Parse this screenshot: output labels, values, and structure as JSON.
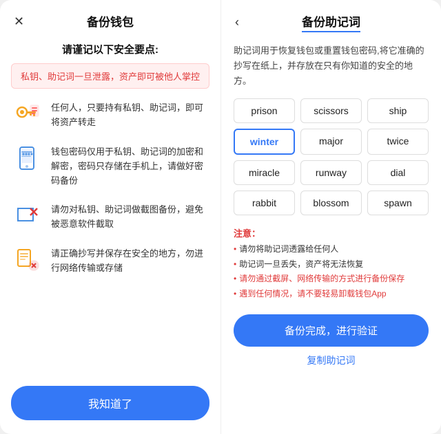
{
  "left": {
    "close_icon": "✕",
    "title": "备份钱包",
    "safety_title": "请谨记以下安全要点:",
    "warning": "私钥、助记词一旦泄露，资产即可被他人掌控",
    "items": [
      {
        "id": "key",
        "text": "任何人，只要持有私钥、助记词，即可将资产转走"
      },
      {
        "id": "phone",
        "text": "钱包密码仅用于私钥、助记词的加密和解密，密码只存储在手机上，请做好密码备份"
      },
      {
        "id": "screenshot",
        "text": "请勿对私钥、助记词做截图备份，避免被恶意软件截取"
      },
      {
        "id": "doc",
        "text": "请正确抄写并保存在安全的地方，勿进行网络传输或存储"
      }
    ],
    "confirm_label": "我知道了"
  },
  "right": {
    "back_icon": "‹",
    "title": "备份助记词",
    "description": "助记词用于恢复钱包或重置钱包密码,将它准确的抄写在纸上，并存放在只有你知道的安全的地方。",
    "words": [
      {
        "text": "prison",
        "highlighted": false
      },
      {
        "text": "scissors",
        "highlighted": false
      },
      {
        "text": "ship",
        "highlighted": false
      },
      {
        "text": "winter",
        "highlighted": true
      },
      {
        "text": "major",
        "highlighted": false
      },
      {
        "text": "twice",
        "highlighted": false
      },
      {
        "text": "miracle",
        "highlighted": false
      },
      {
        "text": "runway",
        "highlighted": false
      },
      {
        "text": "dial",
        "highlighted": false
      },
      {
        "text": "rabbit",
        "highlighted": false
      },
      {
        "text": "blossom",
        "highlighted": false
      },
      {
        "text": "spawn",
        "highlighted": false
      }
    ],
    "notes_title": "注意：",
    "notes": [
      {
        "text": "请勿将助记词透露给任何人",
        "red": false
      },
      {
        "text": "助记词一旦丢失，资产将无法恢复",
        "red": false
      },
      {
        "text": "请勿通过截屏、网络传输的方式进行备份保存",
        "red": true
      },
      {
        "text": "遇到任何情况，请不要轻易卸载钱包App",
        "red": true
      }
    ],
    "backup_btn_label": "备份完成，进行验证",
    "copy_label": "复制助记词"
  }
}
